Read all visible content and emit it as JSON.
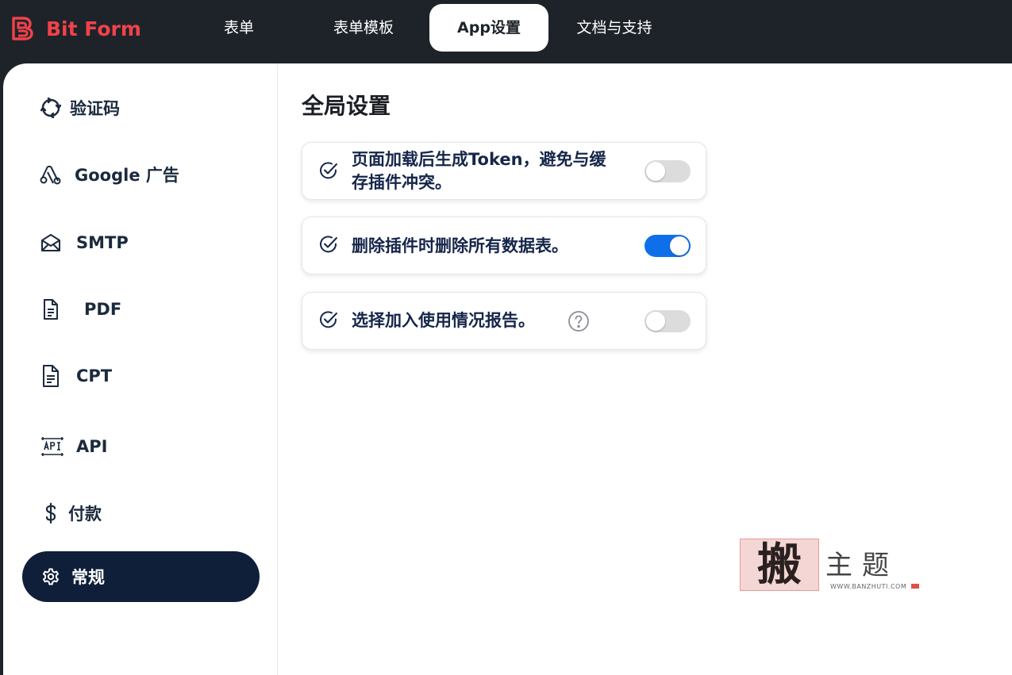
{
  "brand": {
    "name": "Bit Form",
    "color": "#f0424a",
    "icon": "bitform-logo"
  },
  "nav": {
    "items": [
      {
        "label": "表单",
        "active": false
      },
      {
        "label": "表单模板",
        "active": false
      },
      {
        "label": "App设置",
        "active": true
      },
      {
        "label": "文档与支持",
        "active": false
      }
    ]
  },
  "sidebar": {
    "items": [
      {
        "label": "验证码",
        "icon": "captcha-icon",
        "active": false
      },
      {
        "label": "Google 广告",
        "icon": "google-ads-icon",
        "active": false
      },
      {
        "label": "SMTP",
        "icon": "mail-icon",
        "active": false
      },
      {
        "label": "PDF",
        "icon": "document-icon",
        "active": false
      },
      {
        "label": "CPT",
        "icon": "document-icon",
        "active": false
      },
      {
        "label": "API",
        "icon": "api-icon",
        "active": false
      },
      {
        "label": "付款",
        "icon": "dollar-icon",
        "active": false
      },
      {
        "label": "常规",
        "icon": "gear-icon",
        "active": true
      }
    ]
  },
  "main": {
    "title": "全局设置",
    "settings": [
      {
        "label_line1": "页面加载后生成Token，避免与缓",
        "label_line2": "存插件冲突。",
        "enabled": false
      },
      {
        "label": "删除插件时删除所有数据表。",
        "enabled": true
      },
      {
        "label": "选择加入使用情况报告。",
        "enabled": false,
        "help_icon": "question-circle-icon"
      }
    ]
  },
  "colors": {
    "topbar_bg": "#1e2329",
    "active_sidebar_bg": "#0f1f3a",
    "toggle_on": "#0f6fe8",
    "toggle_off": "#dcdcdc",
    "label_text": "#16264a"
  },
  "watermark": {
    "seal_char": "搬",
    "title": "主题",
    "url": "WWW.BANZHUTI.COM"
  }
}
